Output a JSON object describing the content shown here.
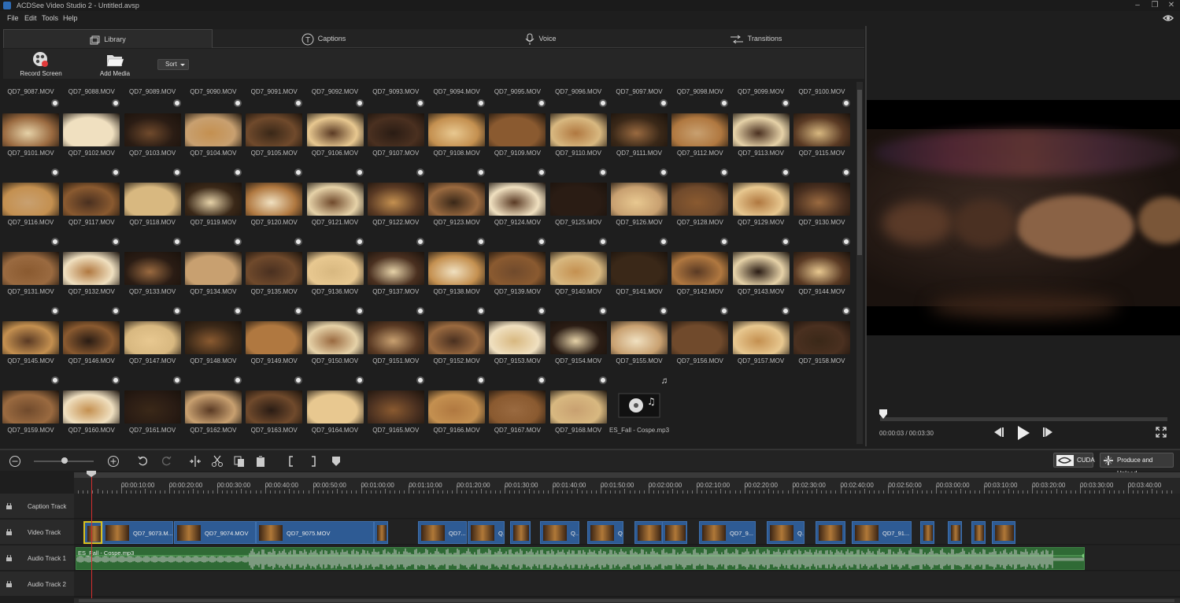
{
  "window": {
    "title": "ACDSee Video Studio 2 - Untitled.avsp"
  },
  "menu": [
    "File",
    "Edit",
    "Tools",
    "Help"
  ],
  "tabs": [
    {
      "label": "Library",
      "icon": "library-icon",
      "active": true
    },
    {
      "label": "Captions",
      "icon": "captions-icon"
    },
    {
      "label": "Voice",
      "icon": "microphone-icon"
    },
    {
      "label": "Transitions",
      "icon": "transitions-icon"
    }
  ],
  "library_tools": {
    "record_screen": "Record Screen",
    "add_media": "Add Media",
    "sort": "Sort"
  },
  "media_rows": [
    [
      "QD7_9087.MOV",
      "QD7_9088.MOV",
      "QD7_9089.MOV",
      "QD7_9090.MOV",
      "QD7_9091.MOV",
      "QD7_9092.MOV",
      "QD7_9093.MOV",
      "QD7_9094.MOV",
      "QD7_9095.MOV",
      "QD7_9096.MOV",
      "QD7_9097.MOV",
      "QD7_9098.MOV",
      "QD7_9099.MOV",
      "QD7_9100.MOV"
    ],
    [
      "QD7_9101.MOV",
      "QD7_9102.MOV",
      "QD7_9103.MOV",
      "QD7_9104.MOV",
      "QD7_9105.MOV",
      "QD7_9106.MOV",
      "QD7_9107.MOV",
      "QD7_9108.MOV",
      "QD7_9109.MOV",
      "QD7_9110.MOV",
      "QD7_9111.MOV",
      "QD7_9112.MOV",
      "QD7_9113.MOV",
      "QD7_9115.MOV"
    ],
    [
      "QD7_9116.MOV",
      "QD7_9117.MOV",
      "QD7_9118.MOV",
      "QD7_9119.MOV",
      "QD7_9120.MOV",
      "QD7_9121.MOV",
      "QD7_9122.MOV",
      "QD7_9123.MOV",
      "QD7_9124.MOV",
      "QD7_9125.MOV",
      "QD7_9126.MOV",
      "QD7_9128.MOV",
      "QD7_9129.MOV",
      "QD7_9130.MOV"
    ],
    [
      "QD7_9131.MOV",
      "QD7_9132.MOV",
      "QD7_9133.MOV",
      "QD7_9134.MOV",
      "QD7_9135.MOV",
      "QD7_9136.MOV",
      "QD7_9137.MOV",
      "QD7_9138.MOV",
      "QD7_9139.MOV",
      "QD7_9140.MOV",
      "QD7_9141.MOV",
      "QD7_9142.MOV",
      "QD7_9143.MOV",
      "QD7_9144.MOV"
    ],
    [
      "QD7_9145.MOV",
      "QD7_9146.MOV",
      "QD7_9147.MOV",
      "QD7_9148.MOV",
      "QD7_9149.MOV",
      "QD7_9150.MOV",
      "QD7_9151.MOV",
      "QD7_9152.MOV",
      "QD7_9153.MOV",
      "QD7_9154.MOV",
      "QD7_9155.MOV",
      "QD7_9156.MOV",
      "QD7_9157.MOV",
      "QD7_9158.MOV"
    ],
    [
      "QD7_9159.MOV",
      "QD7_9160.MOV",
      "QD7_9161.MOV",
      "QD7_9162.MOV",
      "QD7_9163.MOV",
      "QD7_9164.MOV",
      "QD7_9165.MOV",
      "QD7_9166.MOV",
      "QD7_9167.MOV",
      "QD7_9168.MOV",
      "ES_Fall - Cospe.mp3"
    ]
  ],
  "preview": {
    "timecode": "00:00:03 / 00:03:30"
  },
  "timeline": {
    "cuda": "CUDA",
    "produce": "Produce and Upload",
    "ruler": [
      "00:00:10:00",
      "00:00:20:00",
      "00:00:30:00",
      "00:00:40:00",
      "00:00:50:00",
      "00:01:00:00",
      "00:01:10:00",
      "00:01:20:00",
      "00:01:30:00",
      "00:01:40:00",
      "00:01:50:00",
      "00:02:00:00",
      "00:02:10:00",
      "00:02:20:00",
      "00:02:30:00",
      "00:02:40:00",
      "00:02:50:00",
      "00:03:00:00",
      "00:03:10:00",
      "00:03:20:00",
      "00:03:30:00",
      "00:03:40:00"
    ],
    "tracks": [
      "Caption Track",
      "Video Track",
      "Audio Track 1",
      "Audio Track 2"
    ],
    "video_clips": [
      "",
      "QD7_9073.M...",
      "QD7_9074.MOV",
      "QD7_9075.MOV",
      "",
      "QD7...",
      "Q...",
      "",
      "Q...",
      "Q",
      "",
      "",
      "QD7_9...",
      "Q...",
      "",
      "QD7_91...",
      "",
      "",
      "",
      ""
    ],
    "audio_clip": "ES_Fall - Cospe.mp3"
  },
  "colors": {
    "accent_blue": "#2e5b94",
    "audio_green": "#2f6a35",
    "playhead": "#d32f2f"
  }
}
